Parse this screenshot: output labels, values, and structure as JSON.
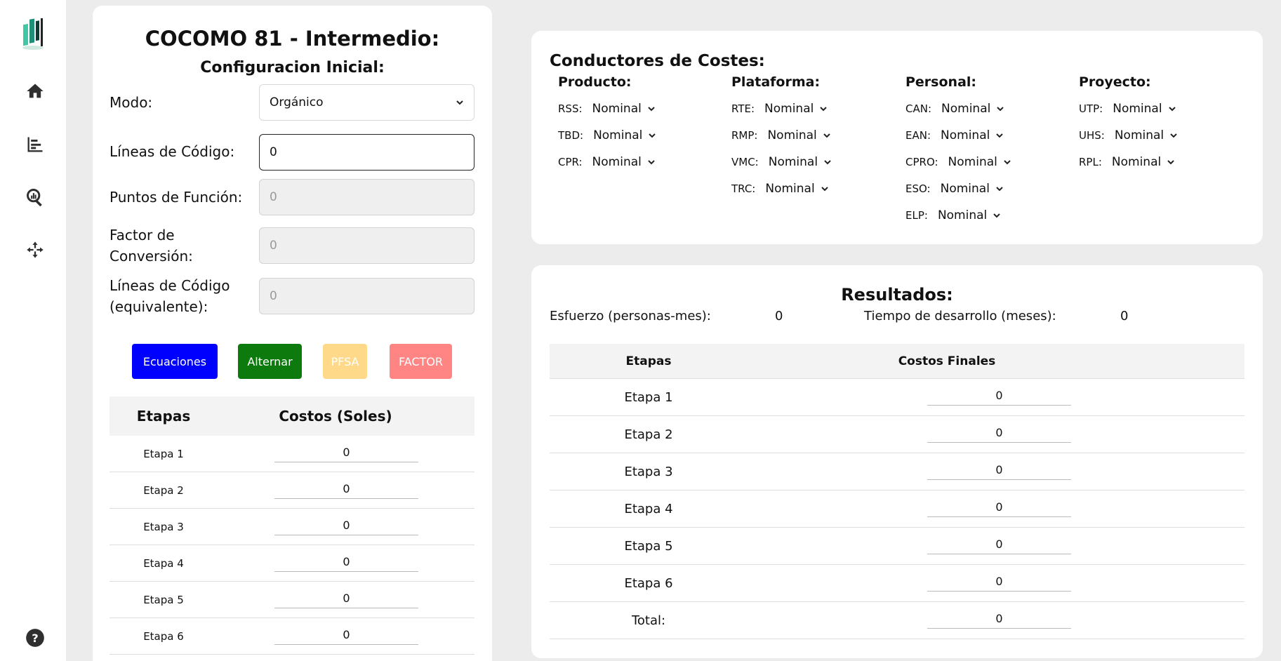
{
  "app": {
    "title": "COCOMO 81 - Intermedio:",
    "subtitle": "Configuracion Inicial:"
  },
  "sidebar": {
    "items": [
      {
        "icon": "home-icon"
      },
      {
        "icon": "bar-list-icon"
      },
      {
        "icon": "search-chart-icon"
      },
      {
        "icon": "arrows-icon"
      }
    ],
    "help_icon": "help-icon"
  },
  "form": {
    "mode_label": "Modo:",
    "mode_value": "Orgánico",
    "loc_label": "Líneas de Código:",
    "loc_value": "0",
    "fp_label": "Puntos de Función:",
    "fp_value": "0",
    "factor_label_1": "Factor de",
    "factor_label_2": "Conversión:",
    "factor_value": "0",
    "loc_eq_label_1": "Líneas de Código",
    "loc_eq_label_2": "(equivalente):",
    "loc_eq_value": "0"
  },
  "buttons": {
    "equations": "Ecuaciones",
    "toggle": "Alternar",
    "pfsa": "PFSA",
    "factor": "FACTOR"
  },
  "costs_table": {
    "header_stage": "Etapas",
    "header_cost": "Costos (Soles)",
    "rows": [
      {
        "stage": "Etapa 1",
        "value": "0"
      },
      {
        "stage": "Etapa 2",
        "value": "0"
      },
      {
        "stage": "Etapa 3",
        "value": "0"
      },
      {
        "stage": "Etapa 4",
        "value": "0"
      },
      {
        "stage": "Etapa 5",
        "value": "0"
      },
      {
        "stage": "Etapa 6",
        "value": "0"
      }
    ]
  },
  "drivers": {
    "title": "Conductores de Costes:",
    "groups": [
      {
        "title": "Producto:",
        "items": [
          {
            "code": "RSS:",
            "value": "Nominal"
          },
          {
            "code": "TBD:",
            "value": "Nominal"
          },
          {
            "code": "CPR:",
            "value": "Nominal"
          }
        ]
      },
      {
        "title": "Plataforma:",
        "items": [
          {
            "code": "RTE:",
            "value": "Nominal"
          },
          {
            "code": "RMP:",
            "value": "Nominal"
          },
          {
            "code": "VMC:",
            "value": "Nominal"
          },
          {
            "code": "TRC:",
            "value": "Nominal"
          }
        ]
      },
      {
        "title": "Personal:",
        "items": [
          {
            "code": "CAN:",
            "value": "Nominal"
          },
          {
            "code": "EAN:",
            "value": "Nominal"
          },
          {
            "code": "CPRO:",
            "value": "Nominal"
          },
          {
            "code": "ESO:",
            "value": "Nominal"
          },
          {
            "code": "ELP:",
            "value": "Nominal"
          }
        ]
      },
      {
        "title": "Proyecto:",
        "items": [
          {
            "code": "UTP:",
            "value": "Nominal"
          },
          {
            "code": "UHS:",
            "value": "Nominal"
          },
          {
            "code": "RPL:",
            "value": "Nominal"
          }
        ]
      }
    ]
  },
  "results": {
    "title": "Resultados:",
    "effort_label": "Esfuerzo (personas-mes):",
    "effort_value": "0",
    "time_label": "Tiempo de desarrollo (meses):",
    "time_value": "0",
    "header_stage": "Etapas",
    "header_cost": "Costos Finales",
    "rows": [
      {
        "stage": "Etapa 1",
        "value": "0"
      },
      {
        "stage": "Etapa 2",
        "value": "0"
      },
      {
        "stage": "Etapa 3",
        "value": "0"
      },
      {
        "stage": "Etapa 4",
        "value": "0"
      },
      {
        "stage": "Etapa 5",
        "value": "0"
      },
      {
        "stage": "Etapa 6",
        "value": "0"
      },
      {
        "stage": "Total:",
        "value": "0"
      }
    ]
  }
}
